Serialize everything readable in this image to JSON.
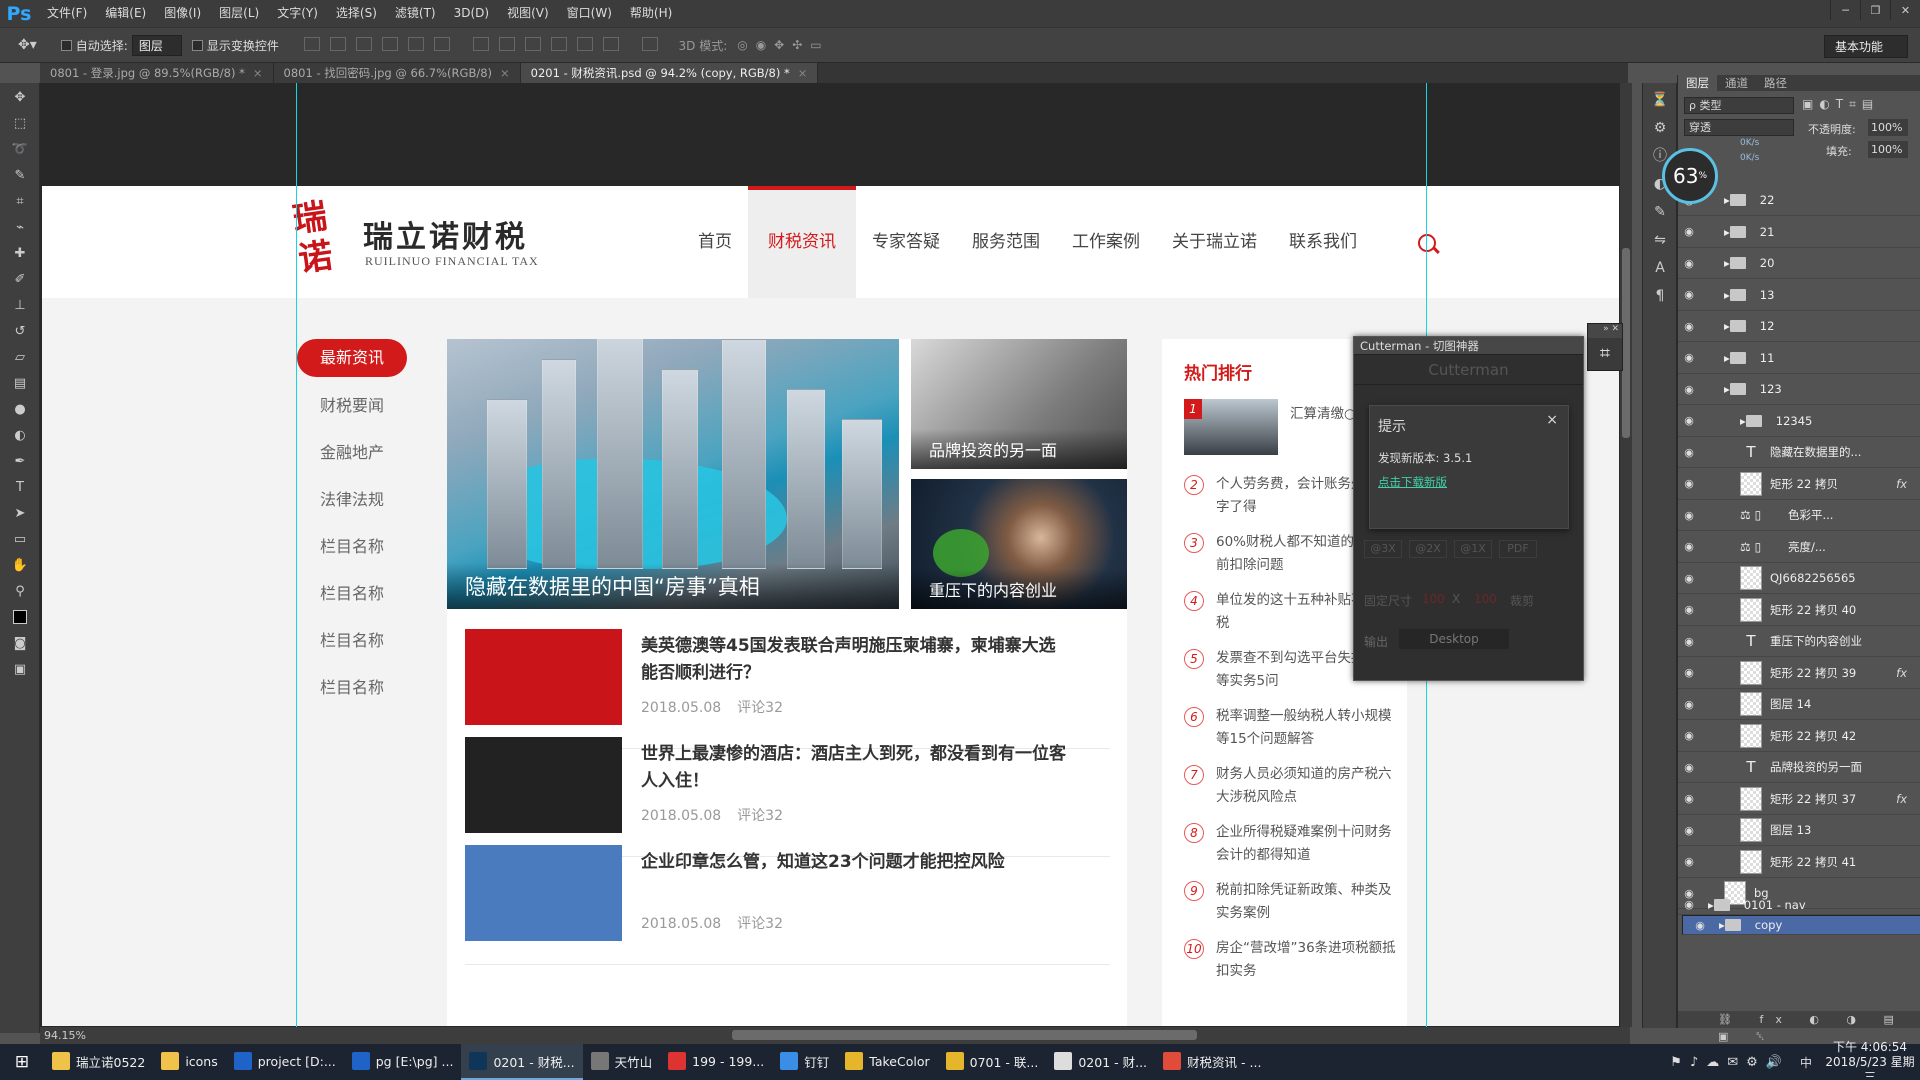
{
  "app": {
    "logo": "Ps"
  },
  "menubar": {
    "items": [
      "文件(F)",
      "编辑(E)",
      "图像(I)",
      "图层(L)",
      "文字(Y)",
      "选择(S)",
      "滤镜(T)",
      "3D(D)",
      "视图(V)",
      "窗口(W)",
      "帮助(H)"
    ]
  },
  "window_controls": {
    "minimize": "─",
    "restore": "❐",
    "close": "✕"
  },
  "options": {
    "auto_select_label": "自动选择:",
    "auto_select_value": "图层",
    "show_transform_label": "显示变换控件",
    "mode3d_label": "3D 模式:",
    "workspace": "基本功能"
  },
  "tabs": [
    {
      "label": "0801 - 登录.jpg @ 89.5%(RGB/8) *",
      "active": false
    },
    {
      "label": "0801 - 找回密码.jpg @ 66.7%(RGB/8)",
      "active": false
    },
    {
      "label": "0201 - 财税资讯.psd @ 94.2% (copy, RGB/8) *",
      "active": true
    }
  ],
  "tab_close": "×",
  "site": {
    "logo_mark": "瑞诺",
    "logo_cn": "瑞立诺财税",
    "logo_en": "RUILINUO FINANCIAL TAX",
    "nav": [
      "首页",
      "财税资讯",
      "专家答疑",
      "服务范围",
      "工作案例",
      "关于瑞立诺",
      "联系我们"
    ],
    "side_nav": [
      "最新资讯",
      "财税要闻",
      "金融地产",
      "法律法规",
      "栏目名称",
      "栏目名称",
      "栏目名称",
      "栏目名称"
    ],
    "hero_caption": "隐藏在数据里的中国“房事”真相",
    "card1_caption": "品牌投资的另一面",
    "card2_caption": "重压下的内容创业",
    "news": [
      {
        "title": "美英德澳等45国发表联合声明施压柬埔寨，柬埔寨大选能否顺利进行？",
        "date": "2018.05.08",
        "comments": "评论32",
        "thumb": "#c9141a"
      },
      {
        "title": "世界上最凄惨的酒店：酒店主人到死，都没看到有一位客人入住！",
        "date": "2018.05.08",
        "comments": "评论32",
        "thumb": "#222"
      },
      {
        "title": "企业印章怎么管，知道这23个问题才能把控风险",
        "date": "2018.05.08",
        "comments": "评论32",
        "thumb": "#4b7bbf"
      }
    ],
    "rank_title": "热门排行",
    "rank": [
      {
        "n": "1",
        "text": "汇算清缴○ 8个收入风"
      },
      {
        "n": "2",
        "text": "个人劳务费，会计账务处理愁字了得"
      },
      {
        "n": "3",
        "text": "60%财税人都不知道的10个税前扣除问题"
      },
      {
        "n": "4",
        "text": "单位发的这十五种补贴不缴个税"
      },
      {
        "n": "5",
        "text": "发票查不到勾选平台失控发票等实务5问"
      },
      {
        "n": "6",
        "text": "税率调整一般纳税人转小规模等15个问题解答"
      },
      {
        "n": "7",
        "text": "财务人员必须知道的房产税六大涉税风险点"
      },
      {
        "n": "8",
        "text": "企业所得税疑难案例十问财务会计的都得知道"
      },
      {
        "n": "9",
        "text": "税前扣除凭证新政策、种类及实务案例"
      },
      {
        "n": "10",
        "text": "房企“营改增”36条进项税额抵扣实务"
      }
    ]
  },
  "cutterman": {
    "title": "Cutterman - 切图神器",
    "header": "Cutterman",
    "dialog_title": "提示",
    "dialog_close": "×",
    "dialog_msg": "发现新版本: 3.5.1",
    "dialog_link": "点击下载新版",
    "scales": [
      "@3X",
      "@2X",
      "@1X",
      "PDF"
    ],
    "fixed_label": "固定尺寸",
    "w": "100",
    "h": "100",
    "x": "X",
    "clip": "裁剪",
    "output": "输出",
    "platform": "Desktop"
  },
  "layers_panel": {
    "tabs": [
      "图层",
      "通道",
      "路径"
    ],
    "filter": "ρ 类型",
    "blend": "穿透",
    "opacity_label": "不透明度:",
    "opacity": "100%",
    "fill_label": "填充:",
    "fill": "100%",
    "perf": "63",
    "net_up": "0K/s",
    "net_down": "0K/s",
    "rows": [
      {
        "type": "folder",
        "name": "22",
        "indent": 1
      },
      {
        "type": "folder",
        "name": "21",
        "indent": 1
      },
      {
        "type": "folder",
        "name": "20",
        "indent": 1
      },
      {
        "type": "folder",
        "name": "13",
        "indent": 1
      },
      {
        "type": "folder",
        "name": "12",
        "indent": 1
      },
      {
        "type": "folder",
        "name": "11",
        "indent": 1
      },
      {
        "type": "folder",
        "name": "123",
        "indent": 1
      },
      {
        "type": "folder",
        "name": "12345",
        "indent": 2
      },
      {
        "type": "text",
        "name": "隐藏在数据里的...",
        "indent": 2
      },
      {
        "type": "shape",
        "name": "矩形 22 拷贝",
        "indent": 2,
        "fx": true
      },
      {
        "type": "adj",
        "name": "色彩平...",
        "indent": 2
      },
      {
        "type": "adj",
        "name": "亮度/...",
        "indent": 2
      },
      {
        "type": "shape",
        "name": "QJ6682256565",
        "indent": 2
      },
      {
        "type": "shape",
        "name": "矩形 22 拷贝 40",
        "indent": 2
      },
      {
        "type": "text",
        "name": "重压下的内容创业",
        "indent": 2
      },
      {
        "type": "shape",
        "name": "矩形 22 拷贝 39",
        "indent": 2,
        "fx": true
      },
      {
        "type": "shape",
        "name": "图层 14",
        "indent": 2
      },
      {
        "type": "shape",
        "name": "矩形 22 拷贝 42",
        "indent": 2
      },
      {
        "type": "text",
        "name": "品牌投资的另一面",
        "indent": 2
      },
      {
        "type": "shape",
        "name": "矩形 22 拷贝 37",
        "indent": 2,
        "fx": true
      },
      {
        "type": "shape",
        "name": "图层 13",
        "indent": 2
      },
      {
        "type": "shape",
        "name": "矩形 22 拷贝 41",
        "indent": 2
      },
      {
        "type": "shape",
        "name": "bg",
        "indent": 1
      },
      {
        "type": "folder",
        "name": "0101 - nav",
        "indent": 0
      },
      {
        "type": "folder",
        "name": "copy",
        "indent": 0,
        "selected": true
      }
    ],
    "fx": "fx"
  },
  "status": {
    "zoom": "94.15%"
  },
  "taskbar": {
    "items": [
      {
        "label": "瑞立诺0522",
        "color": "#f0c24a",
        "active": false
      },
      {
        "label": "icons",
        "color": "#f0c24a",
        "active": false
      },
      {
        "label": "project [D:...",
        "color": "#1f63c8",
        "active": false
      },
      {
        "label": "pg [E:\\pg] ...",
        "color": "#1f63c8",
        "active": false
      },
      {
        "label": "0201 - 财税...",
        "color": "#0f3559",
        "active": true
      },
      {
        "label": "天竹山",
        "color": "#777",
        "active": false
      },
      {
        "label": "199 - 199...",
        "color": "#d33",
        "active": false
      },
      {
        "label": "钉钉",
        "color": "#3a8ee6",
        "active": false
      },
      {
        "label": "TakeColor",
        "color": "#e5b62b",
        "active": false
      },
      {
        "label": "0701 - 联...",
        "color": "#e5b62b",
        "active": false
      },
      {
        "label": "0201 - 财...",
        "color": "#ddd",
        "active": false
      },
      {
        "label": "财税资讯 - ...",
        "color": "#e04b3a",
        "active": false
      }
    ],
    "time": "下午 4:06:54",
    "date": "2018/5/23 星期三",
    "ime": "中"
  }
}
